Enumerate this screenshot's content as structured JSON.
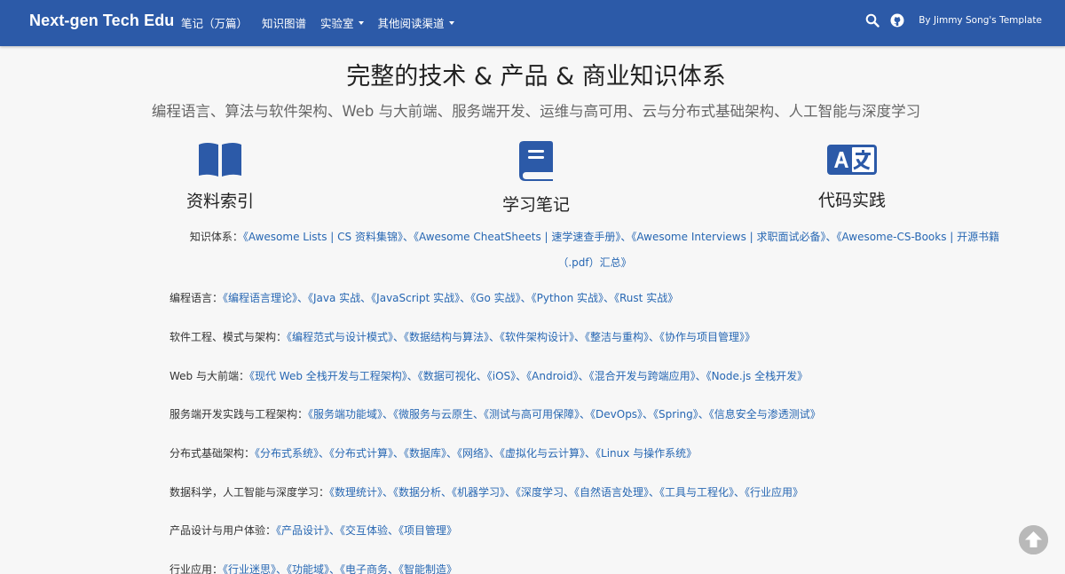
{
  "navbar": {
    "brand": "Next-gen Tech Edu",
    "links": [
      {
        "label": "笔记（万篇）"
      },
      {
        "label": "知识图谱"
      },
      {
        "label": "实验室"
      },
      {
        "label": "其他阅读渠道"
      }
    ],
    "byline": "By Jimmy Song's Template"
  },
  "hero": {
    "title": "完整的技术 & 产品 & 商业知识体系",
    "subtitle": "编程语言、算法与软件架构、Web 与大前端、服务端开发、运维与高可用、云与分布式基础架构、人工智能与深度学习"
  },
  "features": [
    {
      "label": "资料索引",
      "icon": "book-open-icon"
    },
    {
      "label": "学习笔记",
      "icon": "book-icon"
    },
    {
      "label": "代码实践",
      "icon": "language-icon"
    }
  ],
  "intro": {
    "label": "知识体系：",
    "links": "《Awesome Lists | CS 资料集锦》、《Awesome CheatSheets | 速学速查手册》、《Awesome Interviews | 求职面试必备》、《Awesome-CS-Books | 开源书籍（.pdf）汇总》"
  },
  "sections": [
    {
      "label": "编程语言：",
      "links": "《编程语言理论》、《Java 实战、《JavaScript 实战》、《Go 实战》、《Python 实战》、《Rust 实战》"
    },
    {
      "label": "软件工程、模式与架构：",
      "links": "《编程范式与设计模式》、《数据结构与算法》、《软件架构设计》、《整洁与重构》、《协作与项目管理》》"
    },
    {
      "label": "Web 与大前端：",
      "links": "《现代 Web 全栈开发与工程架构》、《数据可视化、《iOS》、《Android》、《混合开发与跨端应用》、《Node.js 全栈开发》"
    },
    {
      "label": "服务端开发实践与工程架构：",
      "links": "《服务端功能域》、《微服务与云原生、《测试与高可用保障》、《DevOps》、《Spring》、《信息安全与渗透测试》"
    },
    {
      "label": "分布式基础架构：",
      "links": "《分布式系统》、《分布式计算》、《数据库》、《网络》、《虚拟化与云计算》、《Linux 与操作系统》"
    },
    {
      "label": "数据科学，人工智能与深度学习：",
      "links": "《数理统计》、《数据分析、《机器学习》、《深度学习、《自然语言处理》、《工具与工程化》、《行业应用》"
    },
    {
      "label": "产品设计与用户体验：",
      "links": "《产品设计》、《交互体验、《项目管理》"
    },
    {
      "label": "行业应用：",
      "links": "《行业迷思》、《功能域》、《电子商务、《智能制造》"
    }
  ],
  "colors": {
    "navbar": "#2c5aa8",
    "link": "#2767b3",
    "icon": "#2c5aa8",
    "background": "#f7f7f7"
  }
}
